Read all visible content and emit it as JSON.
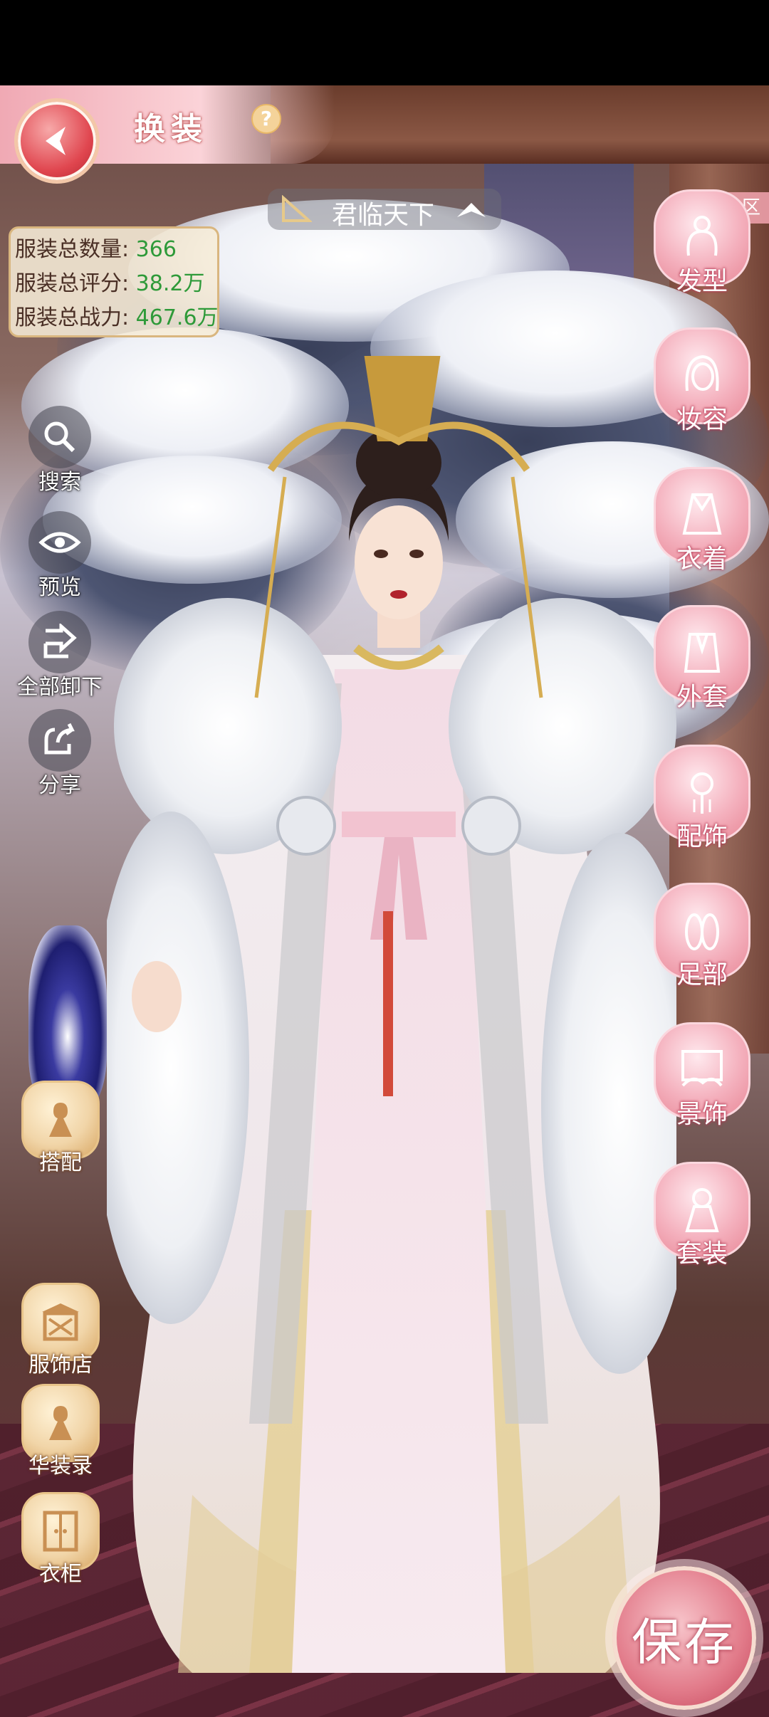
{
  "header": {
    "title": "换装",
    "help_symbol": "?"
  },
  "suit": {
    "name": "君临天下"
  },
  "stats": [
    {
      "label": "服装总数量:",
      "value": "366"
    },
    {
      "label": "服装总评分:",
      "value": "38.2万"
    },
    {
      "label": "服装总战力:",
      "value": "467.6万"
    }
  ],
  "community_label": "社区",
  "left_tools": [
    {
      "label": "搜索",
      "icon": "search-icon"
    },
    {
      "label": "预览",
      "icon": "eye-icon"
    },
    {
      "label": "全部卸下",
      "icon": "unequip-icon"
    },
    {
      "label": "分享",
      "icon": "share-icon"
    }
  ],
  "left_bottom": [
    {
      "label": "搭配",
      "icon": "outfit-match-icon"
    },
    {
      "label": "服饰店",
      "icon": "shop-icon"
    },
    {
      "label": "华装录",
      "icon": "collection-icon"
    },
    {
      "label": "衣柜",
      "icon": "wardrobe-icon"
    }
  ],
  "categories": [
    {
      "label": "发型",
      "icon": "hairstyle-icon"
    },
    {
      "label": "妆容",
      "icon": "makeup-icon"
    },
    {
      "label": "衣着",
      "icon": "clothing-icon"
    },
    {
      "label": "外套",
      "icon": "coat-icon"
    },
    {
      "label": "配饰",
      "icon": "accessory-icon"
    },
    {
      "label": "足部",
      "icon": "shoes-icon"
    },
    {
      "label": "景饰",
      "icon": "scenery-icon"
    },
    {
      "label": "套装",
      "icon": "suit-icon"
    }
  ],
  "save_label": "保存",
  "colors": {
    "accent_pink": "#e88897",
    "stat_green": "#2e9a39",
    "gold": "#d9b67f"
  }
}
